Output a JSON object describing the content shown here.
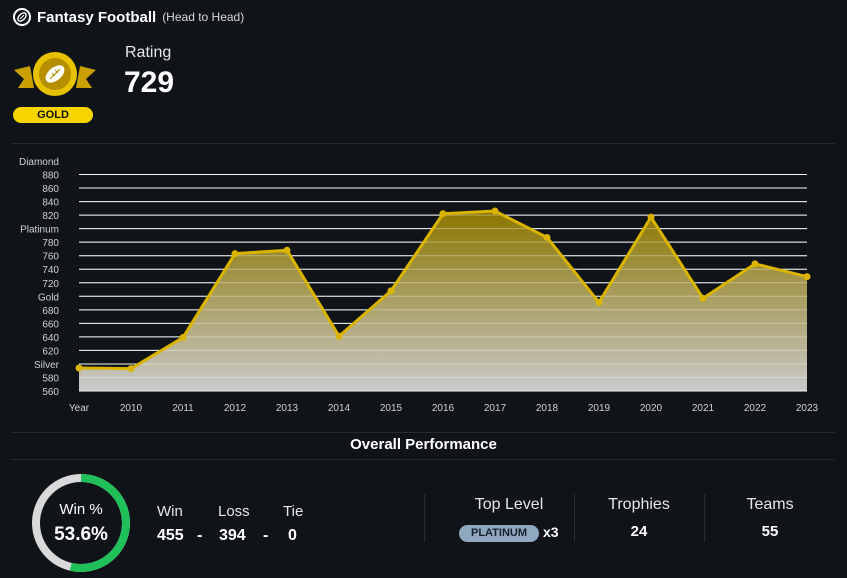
{
  "header": {
    "icon": "football-icon",
    "title": "Fantasy Football",
    "subtitle": "(Head to Head)"
  },
  "badge": {
    "tier": "GOLD",
    "icon": "gold-football-badge-icon"
  },
  "rating": {
    "label": "Rating",
    "value": "729"
  },
  "chart_data": {
    "type": "area",
    "x": [
      "Year",
      "2010",
      "2011",
      "2012",
      "2013",
      "2014",
      "2015",
      "2016",
      "2017",
      "2018",
      "2019",
      "2020",
      "2021",
      "2022",
      "2023"
    ],
    "values": [
      594,
      593,
      639,
      763,
      768,
      641,
      708,
      822,
      826,
      787,
      691,
      817,
      697,
      748,
      729
    ],
    "y_tick_labels": [
      "Diamond",
      "880",
      "860",
      "840",
      "820",
      "Platinum",
      "780",
      "760",
      "740",
      "720",
      "Gold",
      "680",
      "660",
      "640",
      "620",
      "Silver",
      "580",
      "560"
    ],
    "ylim": [
      560,
      900
    ],
    "grid": true,
    "line_color": "#d9b400"
  },
  "performance": {
    "title": "Overall Performance",
    "win_pct_label": "Win %",
    "win_pct_value": "53.6%",
    "win_pct": 53.6,
    "win_label": "Win",
    "loss_label": "Loss",
    "tie_label": "Tie",
    "win": "455",
    "loss": "394",
    "tie": "0",
    "separator": "-",
    "top_level_label": "Top Level",
    "top_level_value": "PLATINUM",
    "top_level_count": "x3",
    "trophies_label": "Trophies",
    "trophies": "24",
    "teams_label": "Teams",
    "teams": "55"
  },
  "colors": {
    "background": "#101418",
    "accent_gold": "#d9b400",
    "ring_green": "#1fc05a",
    "ring_track": "#d9d9d9",
    "platinum": "#8fa7bf"
  }
}
